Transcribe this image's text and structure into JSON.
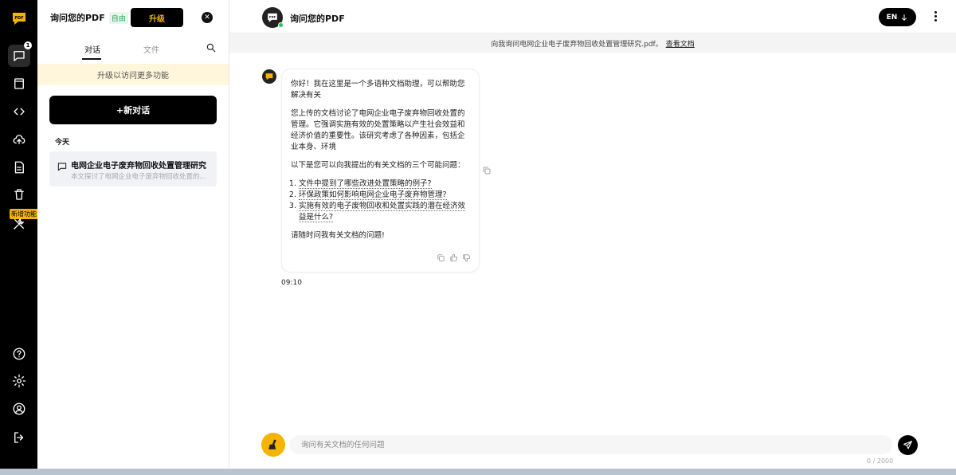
{
  "rail": {
    "notification_count": "1",
    "new_feature_tag": "新增功能",
    "icons": [
      "logo-icon",
      "chat-icon",
      "document-icon",
      "code-icon",
      "upload-icon",
      "file-icon",
      "trash-icon",
      "tools-icon",
      "help-icon",
      "settings-icon",
      "user-icon",
      "logout-icon"
    ]
  },
  "sidebar": {
    "title": "询问您的PDF",
    "plan": "自由",
    "upgrade_label": "升级",
    "tabs": [
      {
        "label": "对话",
        "active": true
      },
      {
        "label": "文件",
        "active": false
      }
    ],
    "upgrade_banner": "升级以访问更多功能",
    "new_chat_label": "+新对话",
    "section_today": "今天",
    "chats": [
      {
        "title": "电网企业电子废弃物回收处置管理研究",
        "summary": "本文探讨了电网企业电子废弃物回收处置的..."
      }
    ]
  },
  "header": {
    "title": "询问您的PDF",
    "lang": "EN",
    "doc_prompt": "向我询问电网企业电子废弃物回收处置管理研究.pdf。",
    "doc_link": "查看文档"
  },
  "message": {
    "greeting": "你好！我在这里是一个多语种文档助理，可以帮助您解决有关",
    "summary": "您上传的文档讨论了电网企业电子废弃物回收处置的管理。它强调实施有效的处置策略以产生社会效益和经济价值的重要性。该研究考虑了各种因素，包括企业本身、环境",
    "questions_intro": "以下是您可以向我提出的有关文档的三个可能问题：",
    "questions": [
      "文件中提到了哪些改进处置策略的例子?",
      "环保政策如何影响电网企业电子废弃物管理?",
      "实施有效的电子废物回收和处置实践的潜在经济效益是什么?"
    ],
    "closing": "请随时问我有关文档的问题!",
    "time": "09:10"
  },
  "input": {
    "placeholder": "询问有关文档的任何问题",
    "value": "",
    "counter": "0 / 2000"
  },
  "colors": {
    "accent": "#f5b400",
    "rail_bg": "#000000",
    "banner_bg": "#fff6dc",
    "online": "#2ec05a"
  }
}
